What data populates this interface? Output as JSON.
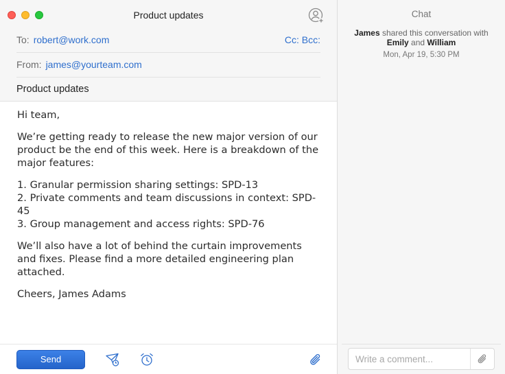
{
  "window": {
    "title": "Product updates"
  },
  "compose": {
    "to_label": "To:",
    "to_value": "robert@work.com",
    "cc_bcc": "Cc: Bcc:",
    "from_label": "From:",
    "from_value": "james@yourteam.com",
    "subject": "Product updates",
    "body": {
      "greeting": "Hi team,",
      "intro": "We’re getting ready to release the new major version of our product be the end of this week. Here is a breakdown of the major features:",
      "items": [
        "1. Granular permission sharing settings: SPD-13",
        "2. Private comments and team discussions in context: SPD-45",
        "3. Group management and access rights: SPD-76"
      ],
      "followup": "We’ll also have a lot of behind the curtain improvements and fixes. Please find a more detailed engineering plan attached.",
      "signoff": "Cheers, James Adams"
    },
    "footer": {
      "send_label": "Send"
    }
  },
  "chat": {
    "title": "Chat",
    "share": {
      "sharer": "James",
      "text1": " shared this conversation with ",
      "user1": "Emily",
      "and": " and ",
      "user2": "William",
      "time": "Mon, Apr 19, 5:30 PM"
    },
    "comment_placeholder": "Write a comment..."
  },
  "icons": {
    "add_contact": "person-add-icon",
    "send_later": "paper-plane-clock-icon",
    "reminder": "alarm-clock-icon",
    "attach": "paperclip-icon"
  },
  "colors": {
    "accent": "#2f6fcd",
    "send_button": "#2b6ad6",
    "close": "#fe5f57",
    "minimize": "#febc2e",
    "maximize": "#28c840"
  }
}
